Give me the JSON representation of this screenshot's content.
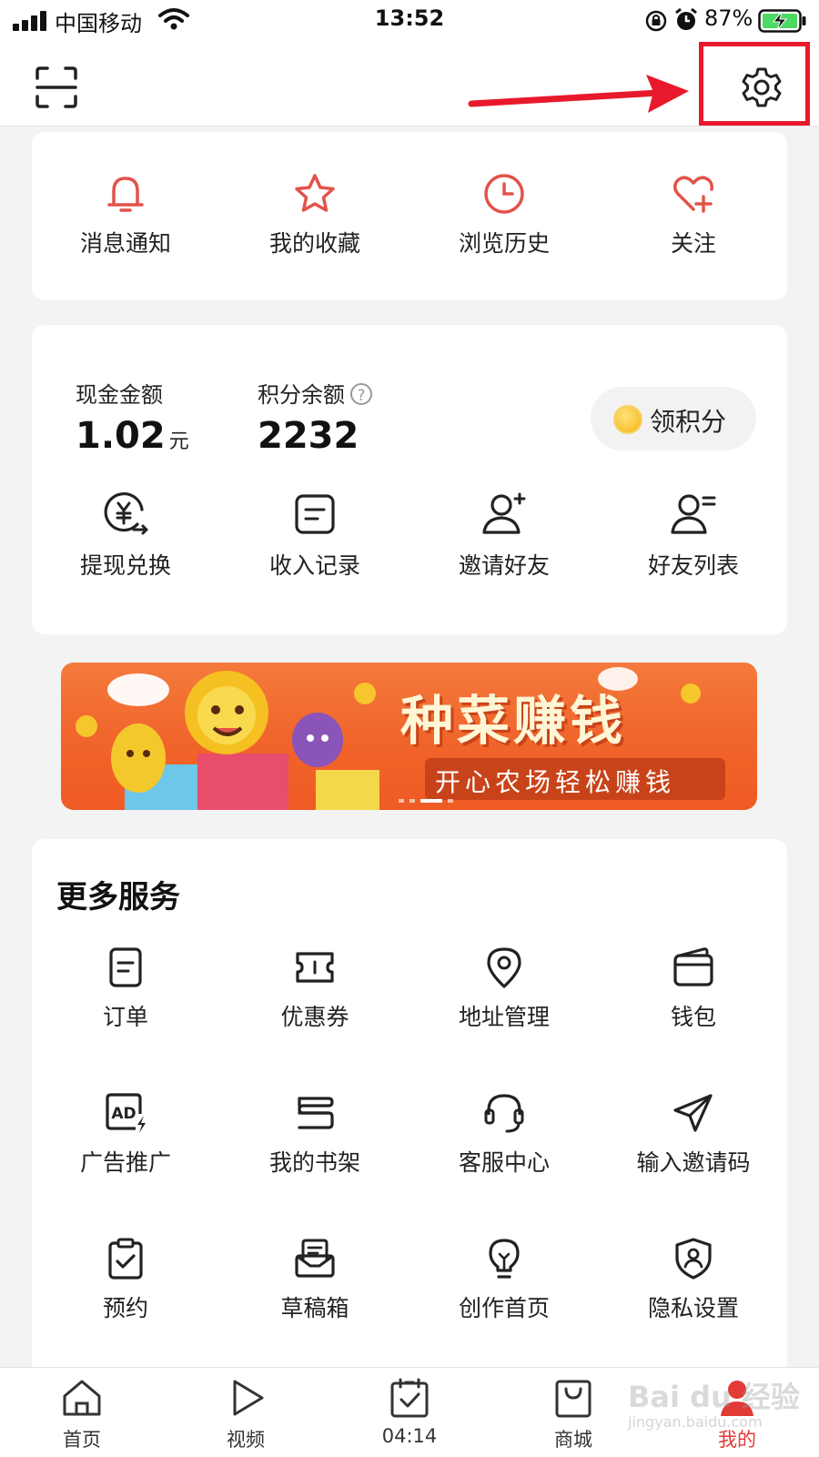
{
  "status_bar": {
    "carrier": "中国移动",
    "time": "13:52",
    "battery_percent": "87%"
  },
  "quick_actions": [
    {
      "label": "消息通知",
      "icon": "bell-icon"
    },
    {
      "label": "我的收藏",
      "icon": "star-icon"
    },
    {
      "label": "浏览历史",
      "icon": "clock-icon"
    },
    {
      "label": "关注",
      "icon": "heart-plus-icon"
    }
  ],
  "wallet": {
    "cash_label": "现金金额",
    "cash_value": "1.02",
    "cash_unit": "元",
    "points_label": "积分余额",
    "points_value": "2232",
    "points_button": "领积分",
    "actions": [
      {
        "label": "提现兑换",
        "icon": "yuan-exchange-icon"
      },
      {
        "label": "收入记录",
        "icon": "record-icon"
      },
      {
        "label": "邀请好友",
        "icon": "add-friend-icon"
      },
      {
        "label": "好友列表",
        "icon": "friend-list-icon"
      }
    ]
  },
  "banner": {
    "title": "种菜赚钱",
    "subtitle": "开心农场轻松赚钱"
  },
  "more_services": {
    "title": "更多服务",
    "items": [
      {
        "label": "订单",
        "icon": "order-icon"
      },
      {
        "label": "优惠券",
        "icon": "coupon-icon"
      },
      {
        "label": "地址管理",
        "icon": "location-icon"
      },
      {
        "label": "钱包",
        "icon": "wallet-icon"
      },
      {
        "label": "广告推广",
        "icon": "ad-icon"
      },
      {
        "label": "我的书架",
        "icon": "bookshelf-icon"
      },
      {
        "label": "客服中心",
        "icon": "headset-icon"
      },
      {
        "label": "输入邀请码",
        "icon": "send-icon"
      },
      {
        "label": "预约",
        "icon": "clipboard-check-icon"
      },
      {
        "label": "草稿箱",
        "icon": "drafts-icon"
      },
      {
        "label": "创作首页",
        "icon": "bulb-icon"
      },
      {
        "label": "隐私设置",
        "icon": "shield-user-icon"
      }
    ]
  },
  "tabs": [
    {
      "label": "首页",
      "icon": "home-icon"
    },
    {
      "label": "视频",
      "icon": "play-icon"
    },
    {
      "label": "04:14",
      "icon": "calendar-check-icon"
    },
    {
      "label": "商城",
      "icon": "shopping-bag-icon"
    },
    {
      "label": "我的",
      "icon": "profile-icon",
      "active": true
    }
  ],
  "watermark": {
    "text": "Bai du 经验",
    "url": "jingyan.baidu.com"
  },
  "colors": {
    "accent_red": "#e23a35",
    "icon_red": "#e2534b",
    "highlight": "#e8192c"
  }
}
